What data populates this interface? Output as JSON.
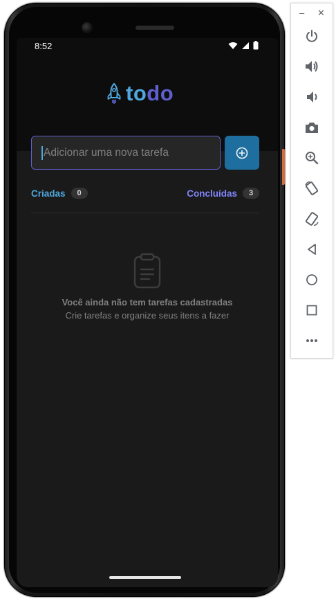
{
  "status_bar": {
    "time": "8:52"
  },
  "app": {
    "logo_part1": "to",
    "logo_part2": "do",
    "input_placeholder": "Adicionar uma nova tarefa",
    "counters": {
      "created_label": "Criadas",
      "created_count": "0",
      "done_label": "Concluídas",
      "done_count": "3"
    },
    "empty": {
      "title": "Você ainda não tem tarefas cadastradas",
      "subtitle": "Crie tarefas e organize seus itens a fazer"
    }
  },
  "colors": {
    "blue": "#4ea8de",
    "purple": "#5e60ce",
    "purple_light": "#8284fa",
    "button_blue": "#1e6f9f",
    "background": "#1a1a1a",
    "header": "#0d0d0d"
  },
  "toolbar": {
    "window_controls": [
      "minimize",
      "close"
    ],
    "buttons": [
      "power-icon",
      "volume-up-icon",
      "volume-down-icon",
      "camera-icon",
      "zoom-icon",
      "rotate-left-icon",
      "rotate-right-icon",
      "back-icon",
      "home-icon",
      "overview-icon",
      "more-icon"
    ]
  }
}
